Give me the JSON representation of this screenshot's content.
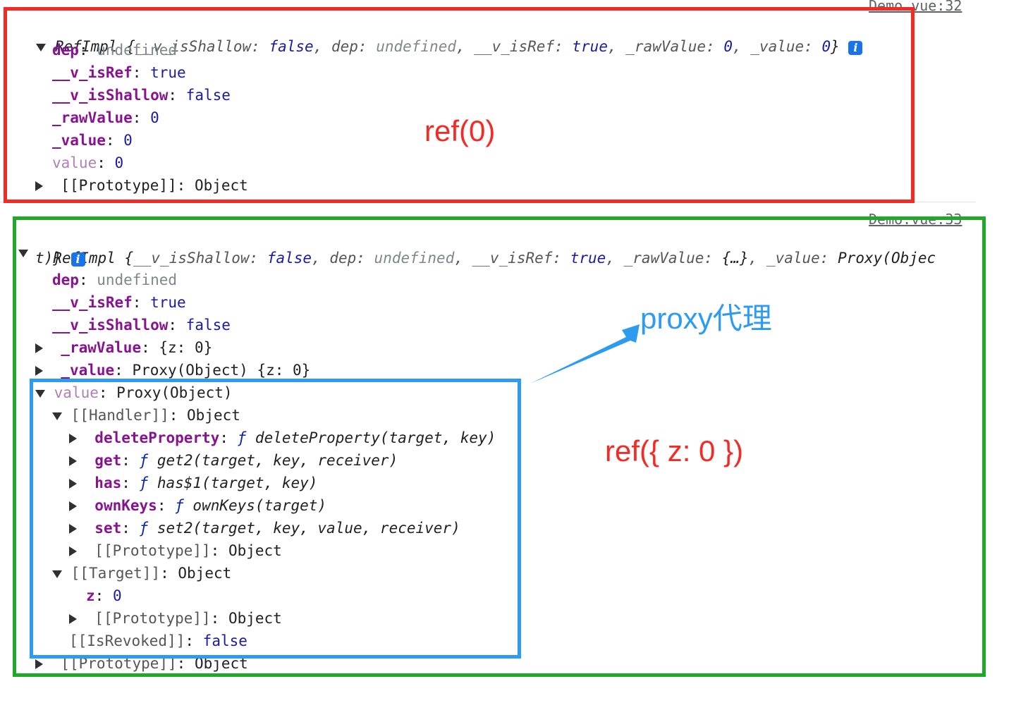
{
  "log1": {
    "source": "Demo.vue:32",
    "summary_class": "RefImpl",
    "summary": {
      "open": "{",
      "k1": "__v_isShallow",
      "v1": "false",
      "k2": "dep",
      "v2": "undefined",
      "k3": "__v_isRef",
      "v3": "true",
      "k4": "_rawValue",
      "v4": "0",
      "k5": "_value",
      "v5": "0",
      "close": "}"
    },
    "props": [
      {
        "key": "dep",
        "value": "undefined"
      },
      {
        "key": "__v_isRef",
        "value": "true"
      },
      {
        "key": "__v_isShallow",
        "value": "false"
      },
      {
        "key": "_rawValue",
        "value": "0"
      },
      {
        "key": "_value",
        "value": "0"
      },
      {
        "key": "value",
        "value": "0"
      },
      {
        "key": "[[Prototype]]",
        "value": "Object"
      }
    ]
  },
  "log2": {
    "source": "Demo.vue:33",
    "summary_class": "RefImpl",
    "summary": {
      "open": "{",
      "k1": "__v_isShallow",
      "v1": "false",
      "k2": "dep",
      "v2": "undefined",
      "k3": "__v_isRef",
      "v3": "true",
      "k4": "_rawValue",
      "v4": "{…}",
      "k5": "_value",
      "v5": "Proxy(Objec",
      "wrap": "t)}"
    },
    "props": [
      {
        "key": "dep",
        "value": "undefined"
      },
      {
        "key": "__v_isRef",
        "value": "true"
      },
      {
        "key": "__v_isShallow",
        "value": "false"
      },
      {
        "key": "_rawValue",
        "value": "{z: 0}"
      },
      {
        "key": "_value",
        "value": "Proxy(Object) {z: 0}"
      }
    ],
    "value_node": {
      "key": "value",
      "value": "Proxy(Object)"
    },
    "handler": {
      "key": "[[Handler]]",
      "value": "Object"
    },
    "handler_items": [
      {
        "key": "deleteProperty",
        "fn": "ƒ",
        "sig": "deleteProperty(target, key)"
      },
      {
        "key": "get",
        "fn": "ƒ",
        "sig": "get2(target, key, receiver)"
      },
      {
        "key": "has",
        "fn": "ƒ",
        "sig": "has$1(target, key)"
      },
      {
        "key": "ownKeys",
        "fn": "ƒ",
        "sig": "ownKeys(target)"
      },
      {
        "key": "set",
        "fn": "ƒ",
        "sig": "set2(target, key, value, receiver)"
      }
    ],
    "handler_proto": {
      "key": "[[Prototype]]",
      "value": "Object"
    },
    "target": {
      "key": "[[Target]]",
      "value": "Object"
    },
    "target_z": {
      "key": "z",
      "value": "0"
    },
    "target_proto": {
      "key": "[[Prototype]]",
      "value": "Object"
    },
    "revoked": {
      "key": "[[IsRevoked]]",
      "value": "false"
    },
    "proto": {
      "key": "[[Prototype]]",
      "value": "Object"
    }
  },
  "annotations": {
    "ref_primitive": "ref(0)",
    "ref_object": "ref({ z: 0 })",
    "proxy": "proxy代理"
  },
  "colors": {
    "red_box": "#f42a25",
    "green_box": "#1fa829",
    "blue_box": "#2d9cf0",
    "red_text": "#f42a25",
    "blue_text": "#2d9cf0"
  }
}
